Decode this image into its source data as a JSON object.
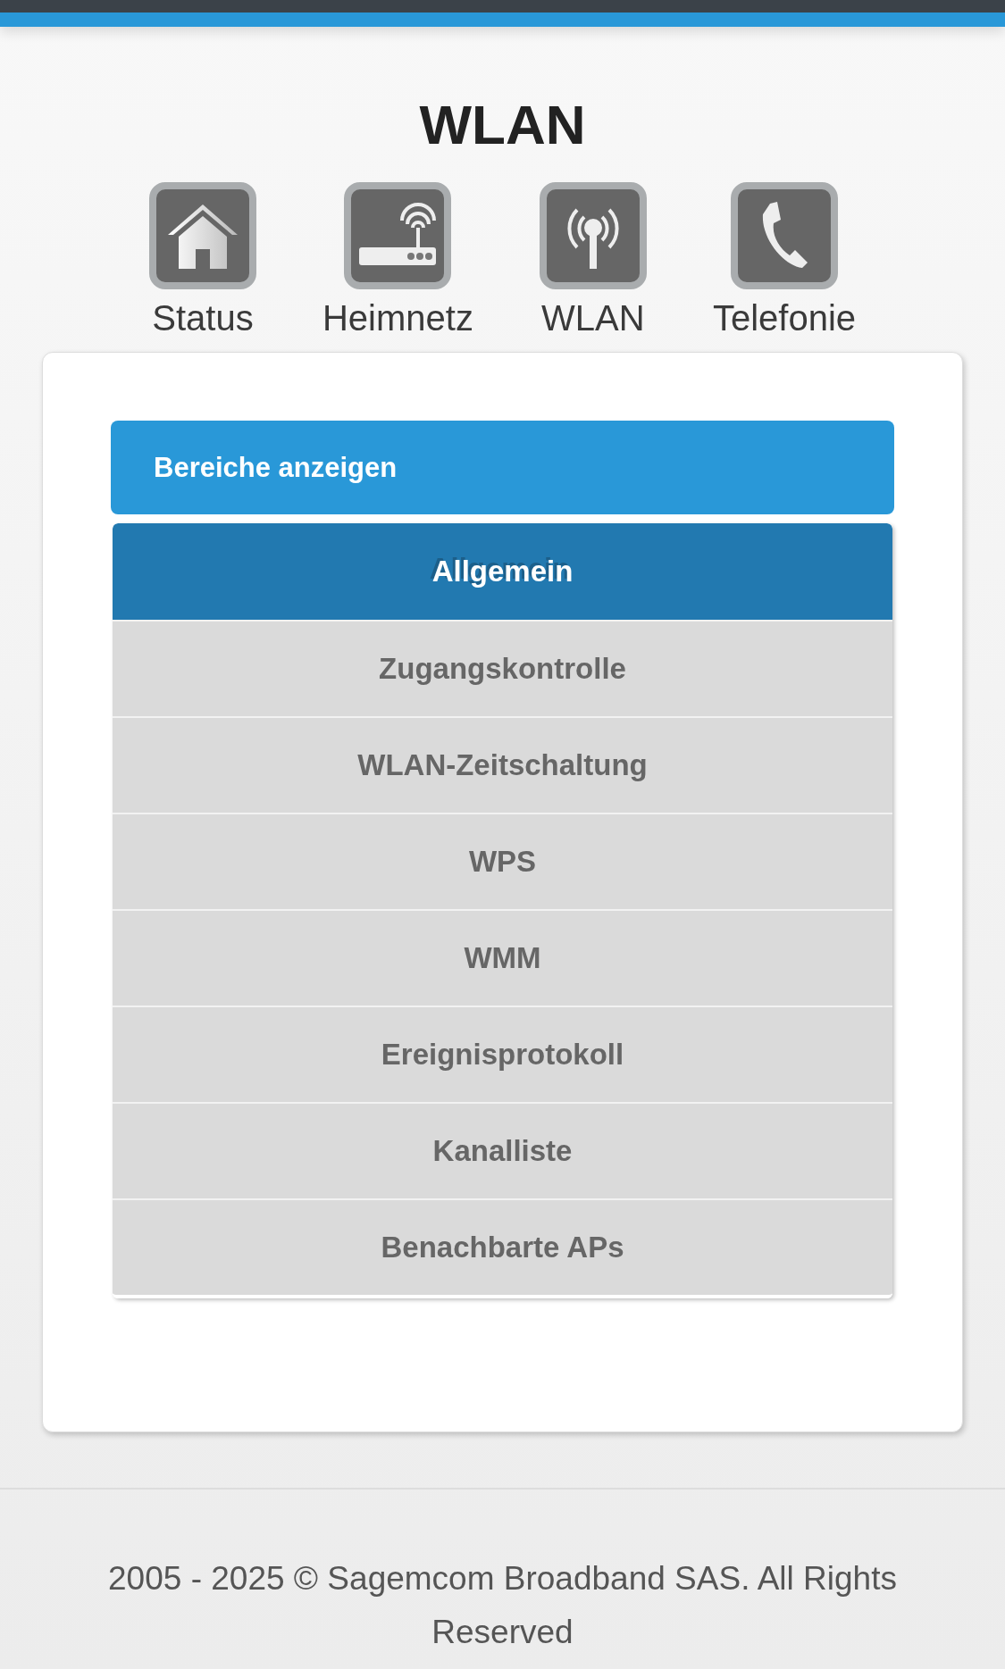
{
  "page_title": "WLAN",
  "nav": [
    {
      "label": "Status"
    },
    {
      "label": "Heimnetz"
    },
    {
      "label": "WLAN"
    },
    {
      "label": "Telefonie"
    }
  ],
  "sections_button": "Bereiche anzeigen",
  "menu": [
    {
      "label": "Allgemein",
      "selected": true
    },
    {
      "label": "Zugangskontrolle",
      "selected": false
    },
    {
      "label": "WLAN-Zeitschaltung",
      "selected": false
    },
    {
      "label": "WPS",
      "selected": false
    },
    {
      "label": "WMM",
      "selected": false
    },
    {
      "label": "Ereignisprotokoll",
      "selected": false
    },
    {
      "label": "Kanalliste",
      "selected": false
    },
    {
      "label": "Benachbarte APs",
      "selected": false
    }
  ],
  "footer": "2005 - 2025 © Sagemcom Broadband SAS. All Rights Reserved"
}
